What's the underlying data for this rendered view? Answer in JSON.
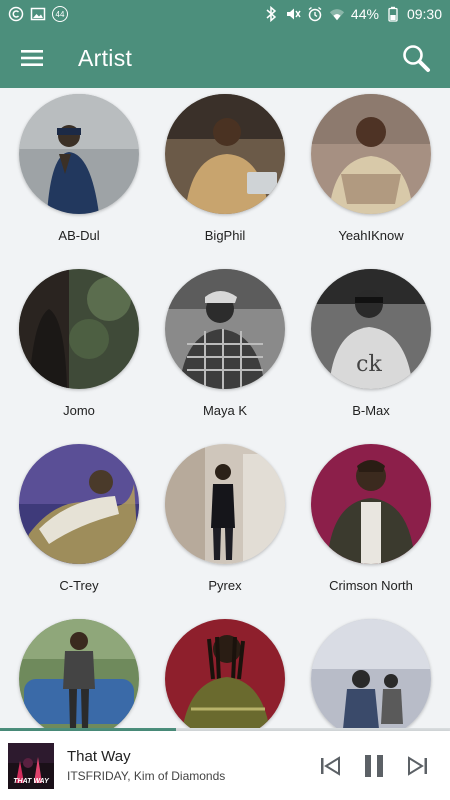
{
  "status_bar": {
    "left_icons": [
      "circle-c-icon",
      "image-icon",
      "notification-badge"
    ],
    "badge_count": "44",
    "right_icons": [
      "bluetooth-icon",
      "mute-icon",
      "alarm-icon",
      "wifi-icon"
    ],
    "battery": "44%",
    "time": "09:30"
  },
  "app_bar": {
    "title": "Artist",
    "menu_icon": "hamburger-menu-icon",
    "search_icon": "search-icon"
  },
  "artists": [
    {
      "name": "AB-Dul"
    },
    {
      "name": "BigPhil"
    },
    {
      "name": "YeahIKnow"
    },
    {
      "name": "Jomo"
    },
    {
      "name": "Maya K"
    },
    {
      "name": "B-Max"
    },
    {
      "name": "C-Trey"
    },
    {
      "name": "Pyrex"
    },
    {
      "name": "Crimson North"
    },
    {
      "name": ""
    },
    {
      "name": ""
    },
    {
      "name": ""
    }
  ],
  "player": {
    "title": "That Way",
    "artist": "ITSFRIDAY, Kim of Diamonds",
    "cover_text": "THAT WAY",
    "progress_fraction": 0.39,
    "controls": [
      "previous-icon",
      "pause-icon",
      "next-icon"
    ]
  },
  "colors": {
    "primary": "#4c8f7c",
    "background": "#f1f3f5"
  }
}
